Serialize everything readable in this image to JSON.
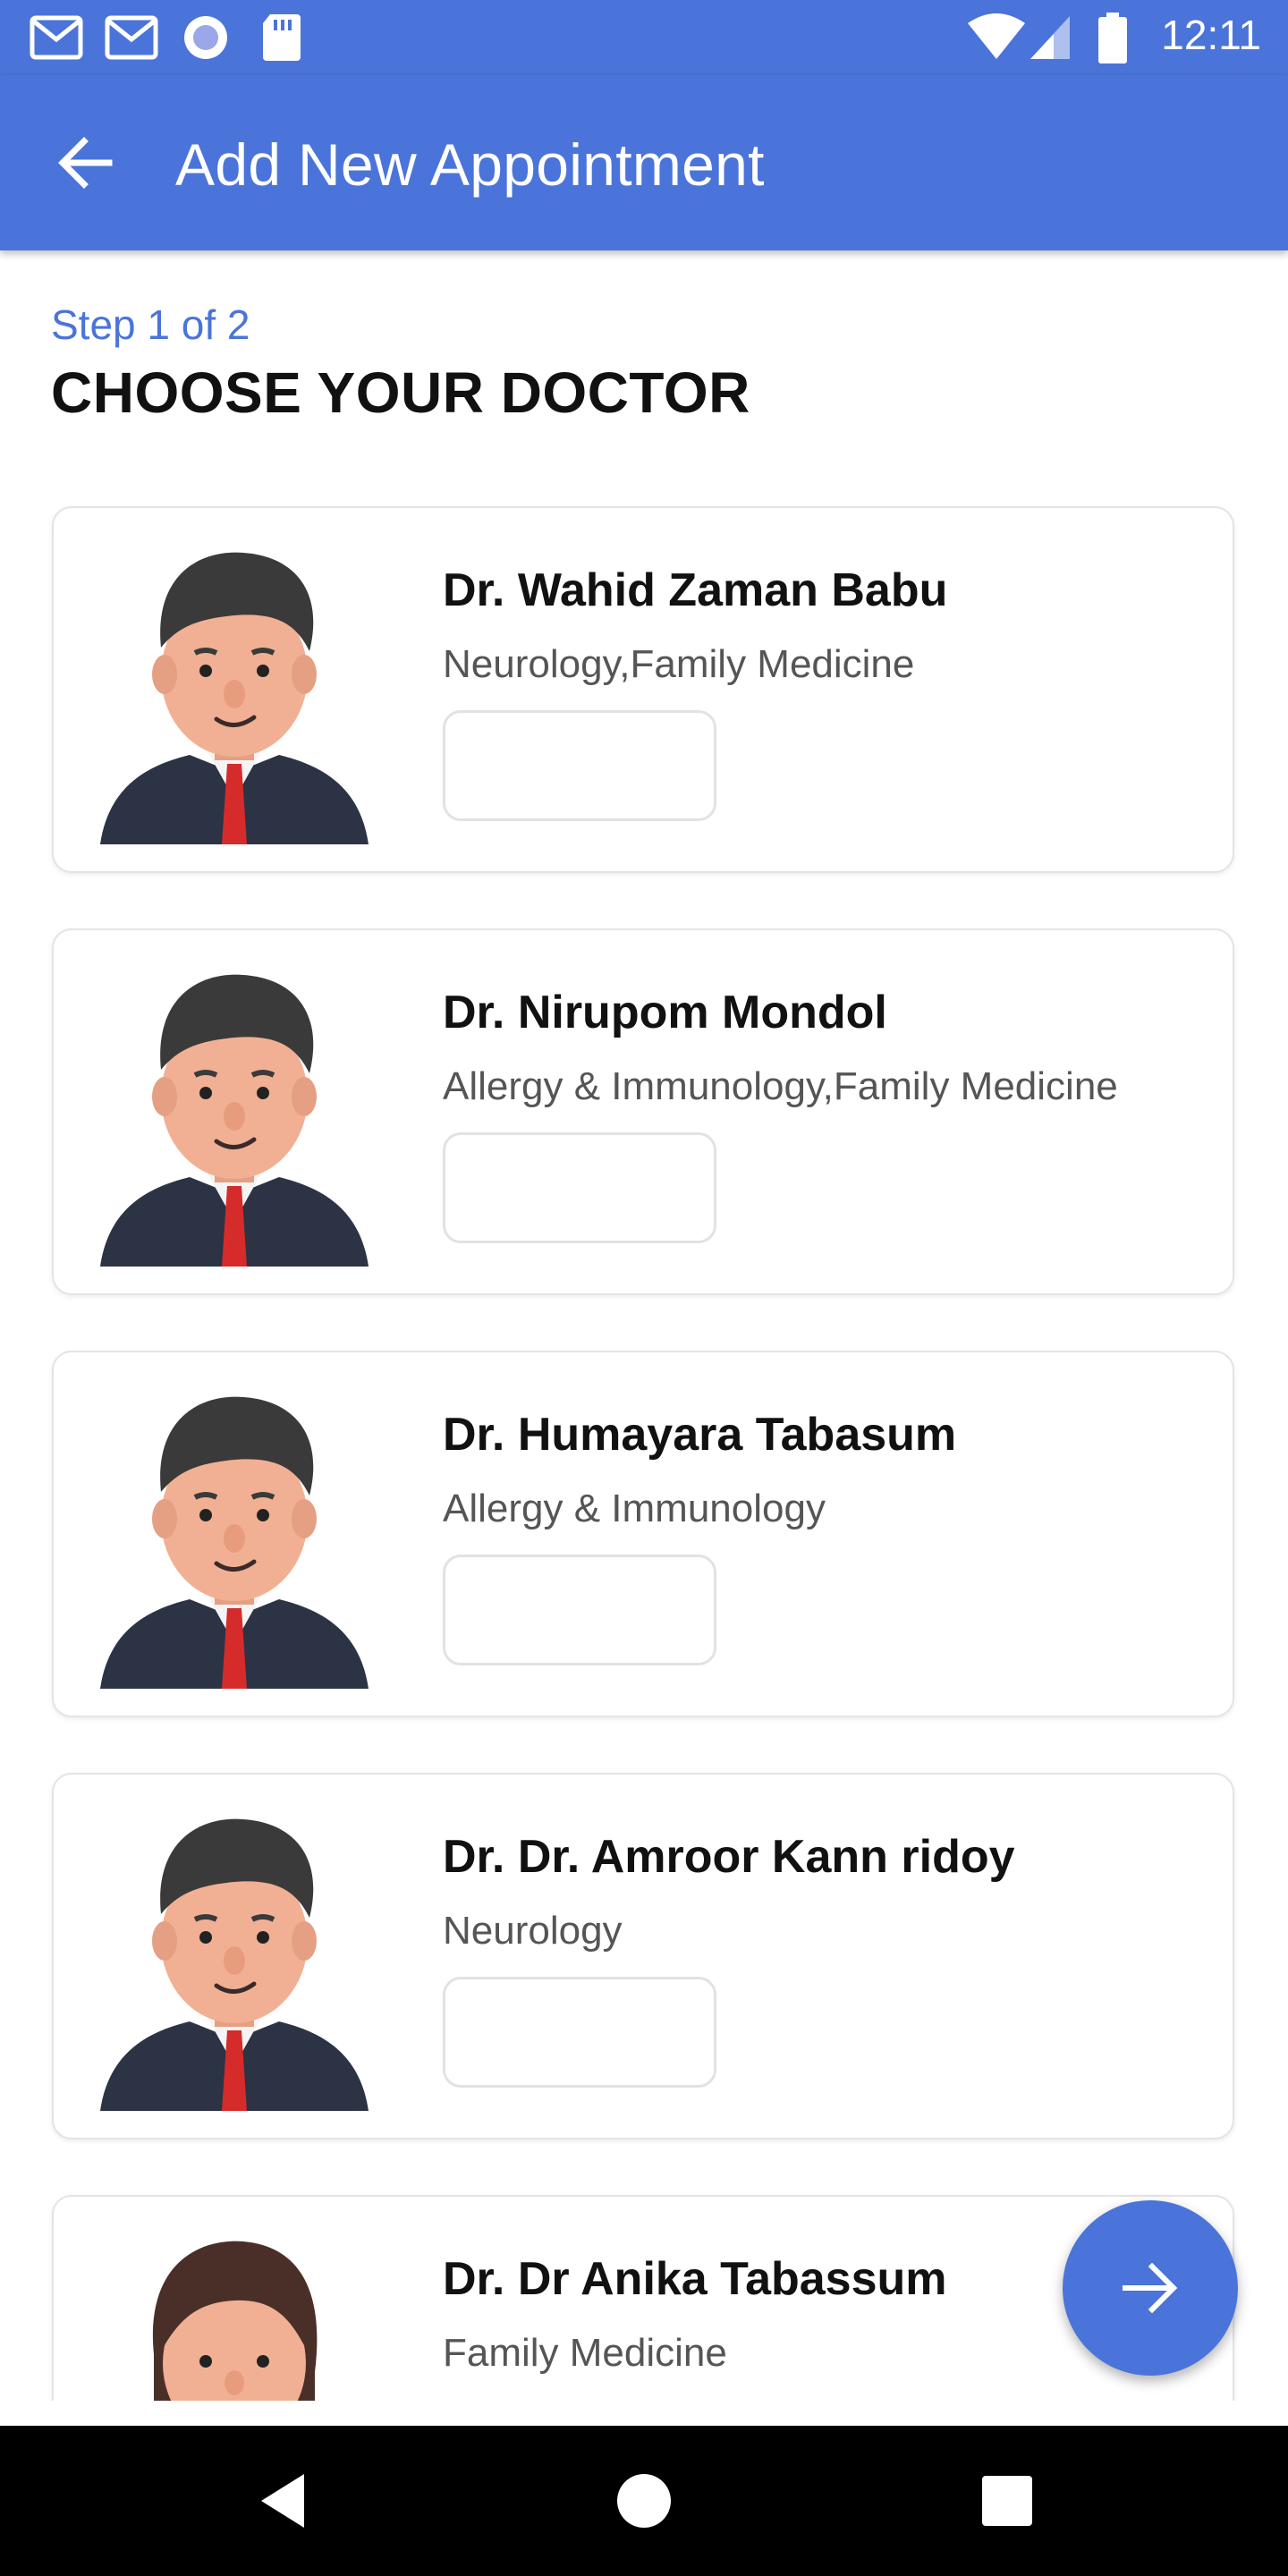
{
  "status_bar": {
    "time": "12:11",
    "icons": [
      "gmail-icon",
      "gmail-icon",
      "circle-notification-icon",
      "sd-card-icon",
      "wifi-icon",
      "signal-icon",
      "battery-icon"
    ]
  },
  "app_bar": {
    "title": "Add New Appointment",
    "back_icon": "arrow-left-icon"
  },
  "step": {
    "label": "Step 1 of 2",
    "title": "CHOOSE YOUR DOCTOR"
  },
  "doctors": [
    {
      "name": "Dr. Wahid Zaman Babu",
      "specialty": "Neurology,Family Medicine",
      "avatar": "male"
    },
    {
      "name": "Dr. Nirupom Mondol",
      "specialty": "Allergy & Immunology,Family Medicine",
      "avatar": "male"
    },
    {
      "name": "Dr. Humayara Tabasum",
      "specialty": "Allergy & Immunology",
      "avatar": "male"
    },
    {
      "name": "Dr. Dr. Amroor Kann ridoy",
      "specialty": "Neurology",
      "avatar": "male"
    },
    {
      "name": "Dr. Dr Anika Tabassum",
      "specialty": "Family Medicine",
      "avatar": "female"
    }
  ],
  "fab": {
    "icon": "arrow-right-icon"
  },
  "nav_bar": {
    "icons": [
      "back-triangle-icon",
      "home-circle-icon",
      "recents-square-icon"
    ]
  },
  "colors": {
    "primary": "#4a74d9",
    "text_dark": "#111111",
    "text_muted": "#555555",
    "card_border": "#e4e4e4"
  }
}
